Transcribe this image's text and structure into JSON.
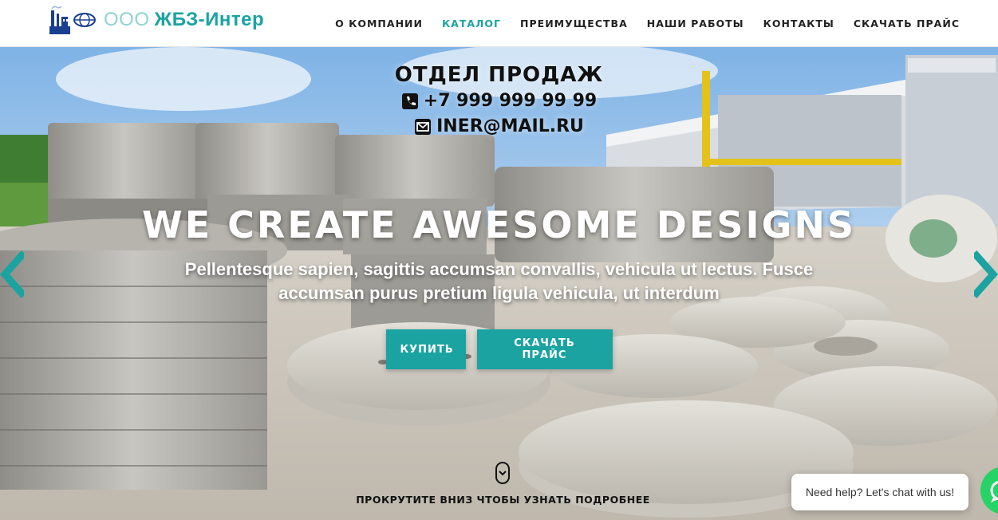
{
  "brand": {
    "prefix": "ООО",
    "name": "ЖБЗ-Интер"
  },
  "nav": {
    "items": [
      {
        "label": "О КОМПАНИИ",
        "active": false
      },
      {
        "label": "КАТАЛОГ",
        "active": true
      },
      {
        "label": "ПРЕИМУЩЕСТВА",
        "active": false
      },
      {
        "label": "НАШИ РАБОТЫ",
        "active": false
      },
      {
        "label": "КОНТАКТЫ",
        "active": false
      },
      {
        "label": "СКАЧАТЬ ПРАЙС",
        "active": false
      }
    ]
  },
  "sales": {
    "title": "ОТДЕЛ ПРОДАЖ",
    "phone": "+7 999 999 99 99",
    "email": "INER@MAIL.RU",
    "phone_icon": "phone-icon",
    "email_icon": "envelope-icon"
  },
  "hero": {
    "headline": "WE CREATE AWESOME DESIGNS",
    "subline": "Pellentesque sapien, sagittis accumsan convallis, vehicula ut lectus. Fusce accumsan purus pretium ligula vehicula, ut interdum",
    "buy_label": "КУПИТЬ",
    "price_label": "СКАЧАТЬ ПРАЙС",
    "prev_icon": "chevron-left-icon",
    "next_icon": "chevron-right-icon"
  },
  "scroll": {
    "icon": "mouse-scroll-icon",
    "text": "ПРОКРУТИТЕ ВНИЗ ЧТОБЫ УЗНАТЬ ПОДРОБНЕЕ"
  },
  "chat": {
    "text": "Need help? Let's chat with us!",
    "icon": "whatsapp-icon"
  },
  "colors": {
    "accent": "#1aa3a1",
    "nav_text": "#222222",
    "headline": "#ffffff"
  }
}
